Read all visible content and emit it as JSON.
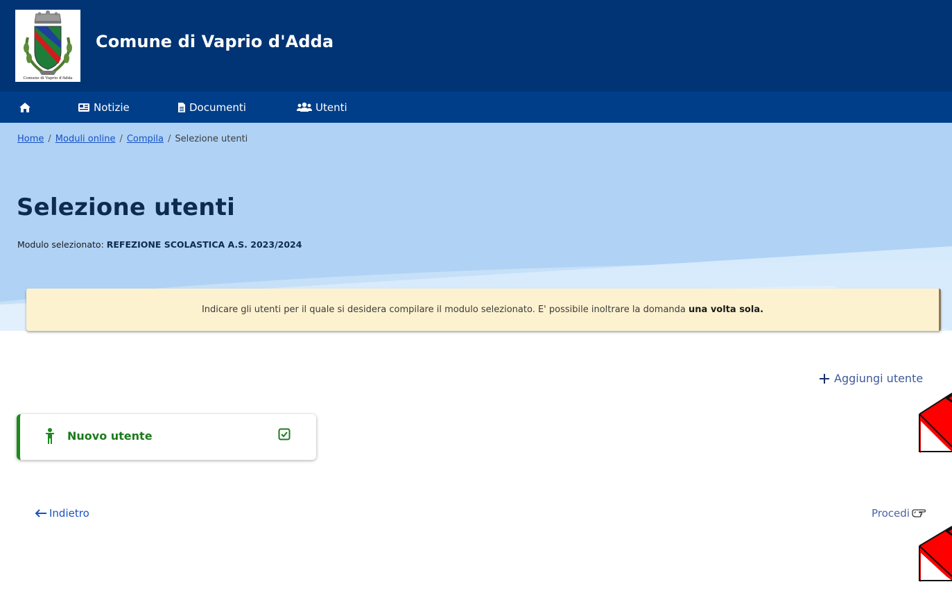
{
  "header": {
    "site_title": "Comune di Vaprio d'Adda",
    "crest_caption": "Comune di Vaprio d'Adda"
  },
  "nav": {
    "home_icon": "home-icon",
    "items": [
      {
        "label": "Notizie",
        "icon": "newspaper-icon"
      },
      {
        "label": "Documenti",
        "icon": "file-icon"
      },
      {
        "label": "Utenti",
        "icon": "users-icon"
      }
    ]
  },
  "breadcrumb": {
    "items": [
      "Home",
      "Moduli online",
      "Compila"
    ],
    "current": "Selezione utenti",
    "separator": "/"
  },
  "page": {
    "title": "Selezione utenti",
    "module_label": "Modulo selezionato:",
    "module_value": "REFEZIONE SCOLASTICA A.S. 2023/2024"
  },
  "alert": {
    "text": "Indicare gli utenti per il quale si desidera compilare il modulo selezionato.  E' possibile inoltrare la domanda",
    "emphasis": "una volta sola."
  },
  "actions": {
    "add_user": "Aggiungi utente",
    "back": "Indietro",
    "proceed": "Procedi"
  },
  "users": [
    {
      "name": "Nuovo utente",
      "selected": true
    }
  ],
  "colors": {
    "header": "#003475",
    "nav": "#003e8a",
    "hero": "#b0d2f5",
    "alert_bg": "#fdf2d0",
    "user_accent": "#1c8a1c",
    "link": "#1652c4",
    "annotation_arrow": "#ff0000"
  }
}
